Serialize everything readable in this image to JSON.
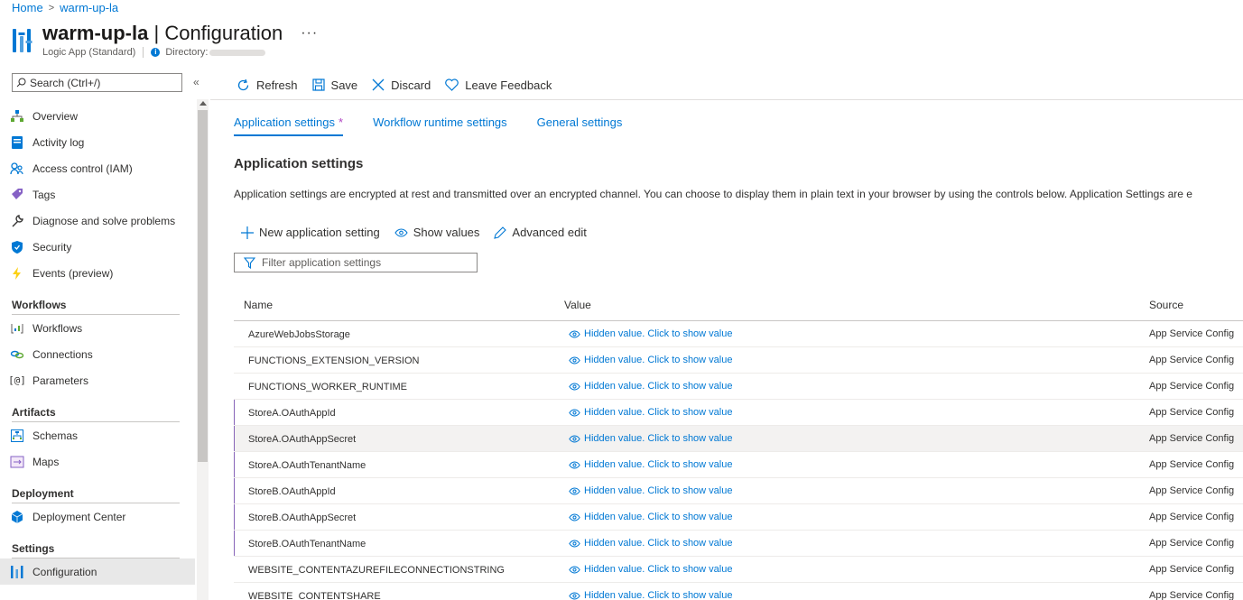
{
  "breadcrumb": {
    "home": "Home",
    "current": "warm-up-la"
  },
  "header": {
    "name": "warm-up-la",
    "separator": "|",
    "section": "Configuration",
    "more": "···",
    "resource_type": "Logic App (Standard)",
    "directory_label": "Directory:"
  },
  "sidebar": {
    "search_placeholder": "Search (Ctrl+/)",
    "collapse": "«",
    "items_top": [
      {
        "label": "Overview",
        "icon": "overview-icon"
      },
      {
        "label": "Activity log",
        "icon": "activity-log-icon"
      },
      {
        "label": "Access control (IAM)",
        "icon": "iam-icon"
      },
      {
        "label": "Tags",
        "icon": "tag-icon"
      },
      {
        "label": "Diagnose and solve problems",
        "icon": "wrench-icon"
      },
      {
        "label": "Security",
        "icon": "shield-icon"
      },
      {
        "label": "Events (preview)",
        "icon": "lightning-icon"
      }
    ],
    "sections": {
      "workflows": "Workflows",
      "artifacts": "Artifacts",
      "deployment": "Deployment",
      "settings": "Settings"
    },
    "workflows_items": [
      {
        "label": "Workflows",
        "icon": "workflows-icon"
      },
      {
        "label": "Connections",
        "icon": "connections-icon"
      },
      {
        "label": "Parameters",
        "icon": "parameters-icon"
      }
    ],
    "artifacts_items": [
      {
        "label": "Schemas",
        "icon": "schemas-icon"
      },
      {
        "label": "Maps",
        "icon": "maps-icon"
      }
    ],
    "deployment_items": [
      {
        "label": "Deployment Center",
        "icon": "deployment-center-icon"
      }
    ],
    "settings_items": [
      {
        "label": "Configuration",
        "icon": "configuration-icon"
      }
    ]
  },
  "toolbar": {
    "refresh": "Refresh",
    "save": "Save",
    "discard": "Discard",
    "feedback": "Leave Feedback"
  },
  "tabs": {
    "app_settings": "Application settings",
    "modified_marker": "*",
    "workflow_runtime": "Workflow runtime settings",
    "general": "General settings"
  },
  "content": {
    "title": "Application settings",
    "description": "Application settings are encrypted at rest and transmitted over an encrypted channel. You can choose to display them in plain text in your browser by using the controls below. Application Settings are e",
    "new_setting": "New application setting",
    "show_values": "Show values",
    "advanced_edit": "Advanced edit",
    "filter_placeholder": "Filter application settings"
  },
  "table": {
    "headers": {
      "name": "Name",
      "value": "Value",
      "source": "Source"
    },
    "hidden_value_text": "Hidden value. Click to show value",
    "rows": [
      {
        "name": "AzureWebJobsStorage",
        "source": "App Service Config"
      },
      {
        "name": "FUNCTIONS_EXTENSION_VERSION",
        "source": "App Service Config"
      },
      {
        "name": "FUNCTIONS_WORKER_RUNTIME",
        "source": "App Service Config"
      },
      {
        "name": "StoreA.OAuthAppId",
        "source": "App Service Config"
      },
      {
        "name": "StoreA.OAuthAppSecret",
        "source": "App Service Config"
      },
      {
        "name": "StoreA.OAuthTenantName",
        "source": "App Service Config"
      },
      {
        "name": "StoreB.OAuthAppId",
        "source": "App Service Config"
      },
      {
        "name": "StoreB.OAuthAppSecret",
        "source": "App Service Config"
      },
      {
        "name": "StoreB.OAuthTenantName",
        "source": "App Service Config"
      },
      {
        "name": "WEBSITE_CONTENTAZUREFILECONNECTIONSTRING",
        "source": "App Service Config"
      },
      {
        "name": "WEBSITE_CONTENTSHARE",
        "source": "App Service Config"
      }
    ]
  },
  "colors": {
    "accent": "#0078d4",
    "modified": "#b146c2",
    "marker": "#8764b8"
  }
}
